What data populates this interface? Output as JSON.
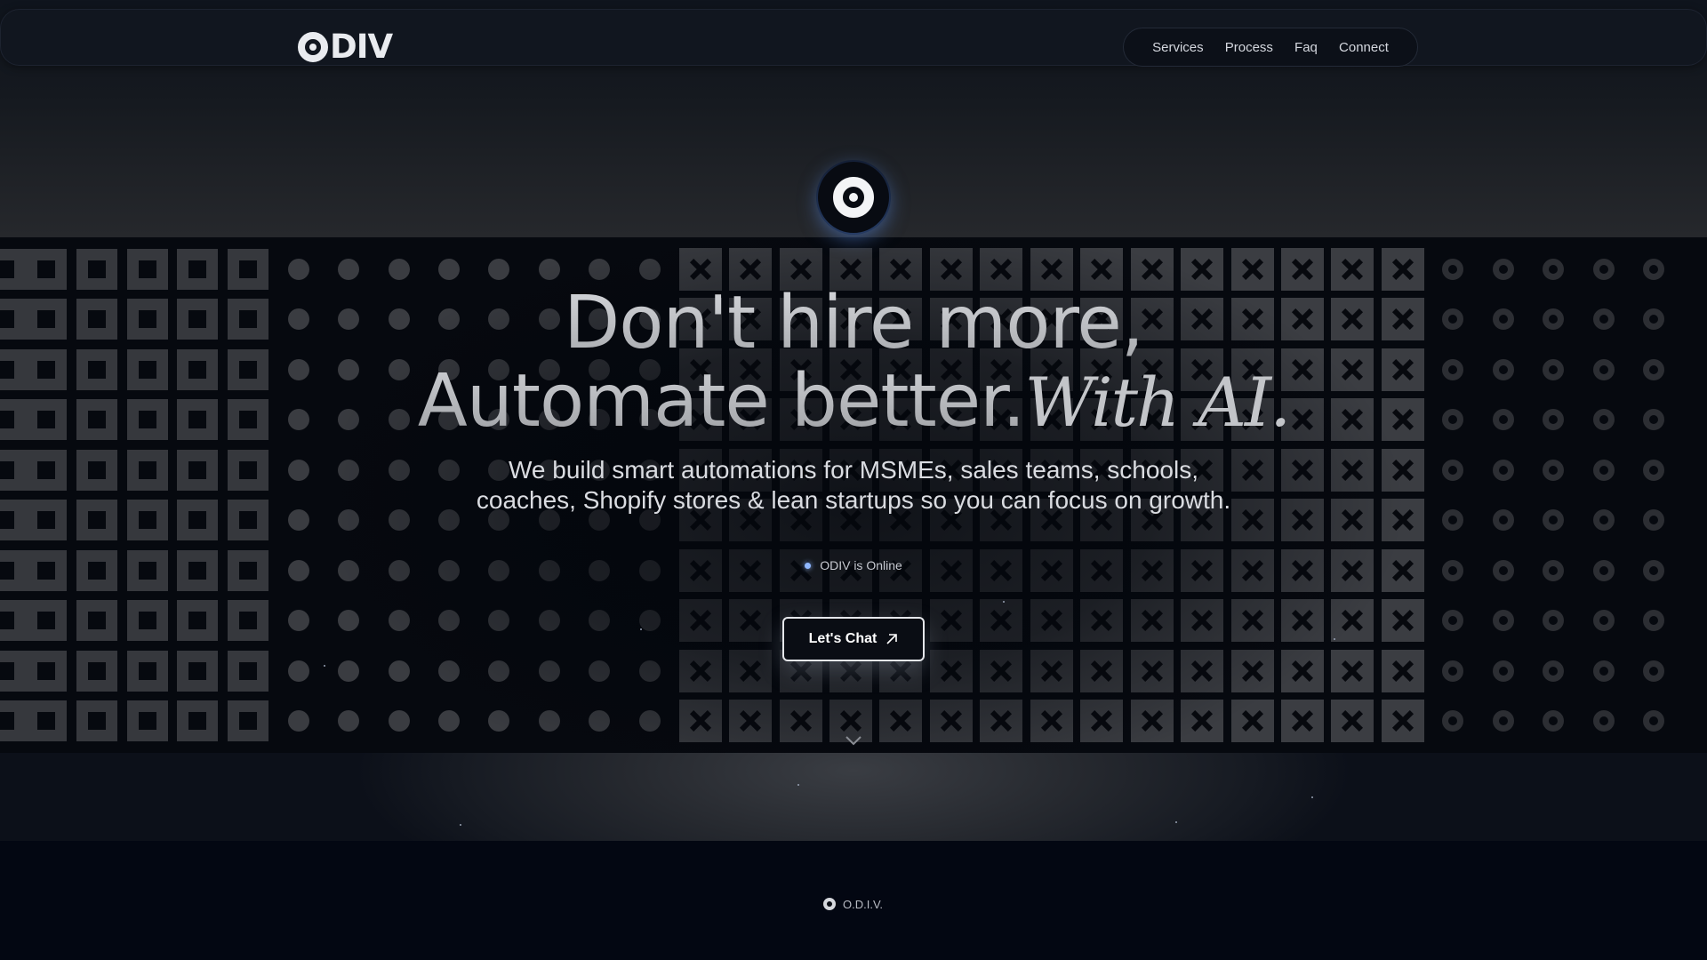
{
  "nav": {
    "logo_text": "DIV",
    "links": [
      {
        "label": "Services"
      },
      {
        "label": "Process"
      },
      {
        "label": "Faq"
      },
      {
        "label": "Connect"
      }
    ]
  },
  "hero": {
    "title_line1": "Don't hire more,",
    "title_line2": "Automate better.",
    "title_accent": "With AI.",
    "subtitle_line1": "We build smart automations for MSMEs, sales teams, schools,",
    "subtitle_line2": "coaches, Shopify stores & lean startups so you can focus on growth.",
    "status_text": "ODIV is Online",
    "cta_label": "Let's Chat"
  },
  "footer": {
    "brand": "O.D.I.V."
  },
  "icons": {
    "logo": "odiv-ring-logo",
    "orb": "ring-logo-orb",
    "cta": "arrow-up-right-icon",
    "scroll": "chevron-down-icon"
  },
  "colors": {
    "background": "#050a14",
    "status_dot": "#8fb7ff",
    "text": "#e6e8ee"
  }
}
